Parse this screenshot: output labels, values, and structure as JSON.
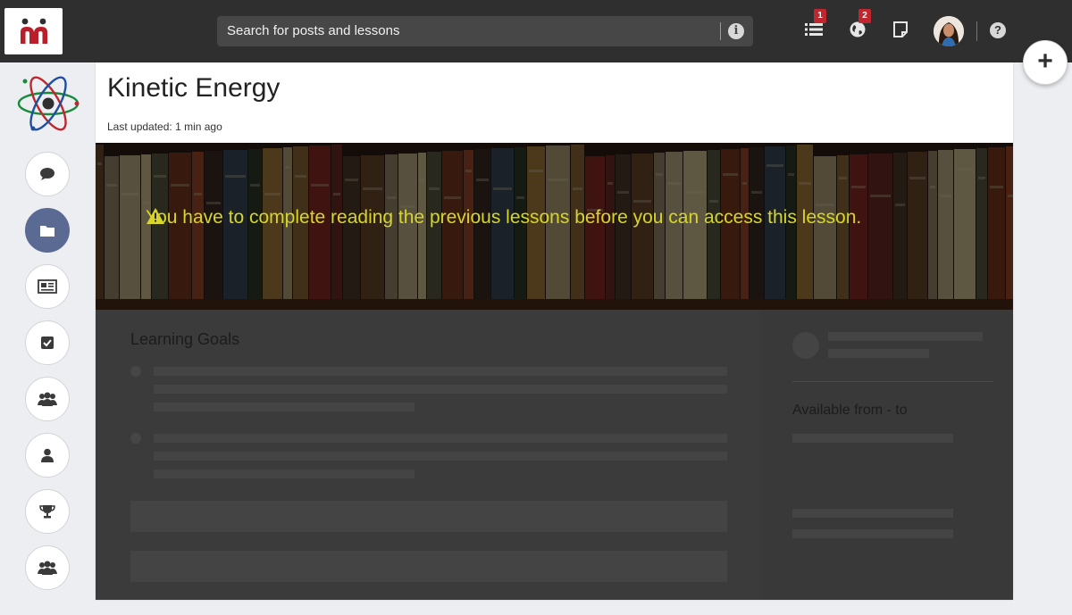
{
  "topbar": {
    "search_placeholder": "Search for posts and lessons",
    "list_badge": "1",
    "globe_badge": "2",
    "help_label": "?",
    "plus_label": "+"
  },
  "lesson": {
    "title": "Kinetic Energy",
    "last_updated_label": "Last updated:",
    "last_updated_value": "1 min ago",
    "warning": "You have to complete reading the previous lessons before you can access this lesson."
  },
  "content": {
    "learning_goals_title": "Learning Goals",
    "available_title": "Available from - to"
  },
  "colors": {
    "topbar": "#2f2f2f",
    "badge": "#c0262d",
    "warning_text": "#d6d62a",
    "active_rail": "#5a6a92"
  },
  "icons": {
    "rail": [
      "comment-icon",
      "folder-icon",
      "news-icon",
      "check-icon",
      "group-icon",
      "user-icon",
      "trophy-icon",
      "group-icon"
    ],
    "topbar": [
      "list-icon",
      "globe-icon",
      "note-icon"
    ]
  }
}
